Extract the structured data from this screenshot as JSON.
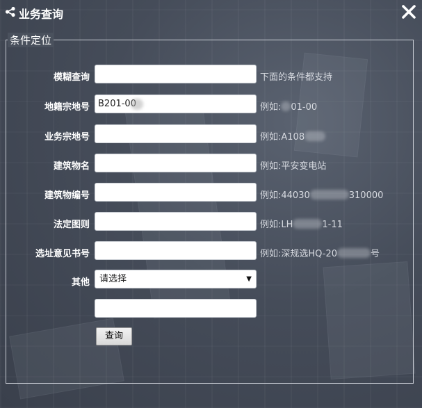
{
  "window": {
    "title": "业务查询",
    "close_symbol": "✕"
  },
  "section": {
    "legend": "条件定位"
  },
  "fields": [
    {
      "label": "模糊查询",
      "value": "",
      "hint": "下面的条件都支持"
    },
    {
      "label": "地籍宗地号",
      "value": "B201-00",
      "hint": "例如:",
      "hint_tail": "01-00"
    },
    {
      "label": "业务宗地号",
      "value": "",
      "hint": "例如:A108",
      "hint_tail": ""
    },
    {
      "label": "建筑物名",
      "value": "",
      "hint": "例如:平安变电站"
    },
    {
      "label": "建筑物编号",
      "value": "",
      "hint": "例如:44030",
      "hint_tail": "310000"
    },
    {
      "label": "法定图则",
      "value": "",
      "hint": "例如:LH",
      "hint_tail": "1-11"
    },
    {
      "label": "选址意见书号",
      "value": "",
      "hint": "例如:深规选HQ-20",
      "hint_tail": "号"
    }
  ],
  "other": {
    "label": "其他",
    "selected": "请选择"
  },
  "extra_input": {
    "value": ""
  },
  "query_button": {
    "label": "查询"
  },
  "colors": {
    "overlay": "#454c59",
    "text": "#ffffff",
    "hint": "#d7dae0"
  }
}
